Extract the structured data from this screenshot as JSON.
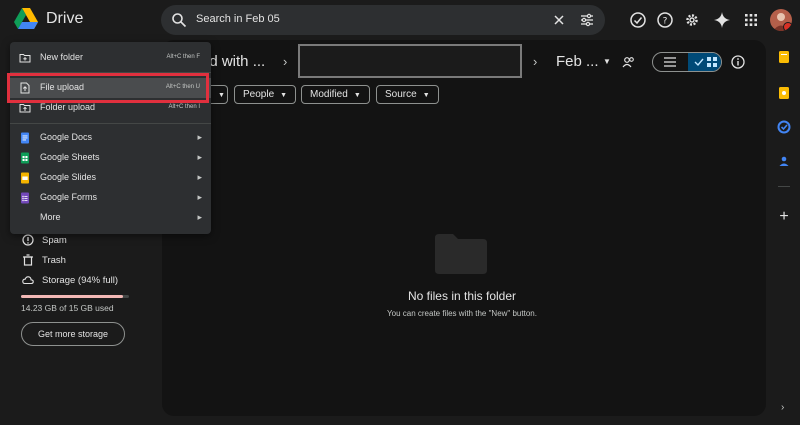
{
  "header": {
    "brand": "Drive",
    "search_text": "Search in Feb 05"
  },
  "breadcrumb": {
    "shared": "ed with ...",
    "current": "Feb ..."
  },
  "filters": [
    {
      "label": "People"
    },
    {
      "label": "Modified"
    },
    {
      "label": "Source"
    }
  ],
  "empty_state": {
    "title": "No files in this folder",
    "subtitle": "You can create files with the \"New\" button."
  },
  "new_menu": {
    "items": [
      {
        "label": "New folder",
        "shortcut": "Alt+C then F",
        "icon": "new-folder-icon"
      },
      {
        "label": "File upload",
        "shortcut": "Alt+C then U",
        "icon": "file-upload-icon"
      },
      {
        "label": "Folder upload",
        "shortcut": "Alt+C then I",
        "icon": "folder-upload-icon"
      },
      {
        "label": "Google Docs",
        "icon": "docs-icon",
        "color": "#4285f4"
      },
      {
        "label": "Google Sheets",
        "icon": "sheets-icon",
        "color": "#0f9d58"
      },
      {
        "label": "Google Slides",
        "icon": "slides-icon",
        "color": "#f4b400"
      },
      {
        "label": "Google Forms",
        "icon": "forms-icon",
        "color": "#7248b9"
      },
      {
        "label": "More"
      }
    ]
  },
  "sidebar": {
    "items": [
      {
        "label": "Spam",
        "icon": "spam-icon"
      },
      {
        "label": "Trash",
        "icon": "trash-icon"
      },
      {
        "label": "Storage (94% full)",
        "icon": "cloud-icon"
      }
    ],
    "storage_used": "14.23 GB of 15 GB used",
    "storage_fraction": 0.94,
    "get_more_storage": "Get more storage"
  },
  "colors": {
    "highlight": "#e1303e",
    "accent": "#004a77"
  }
}
